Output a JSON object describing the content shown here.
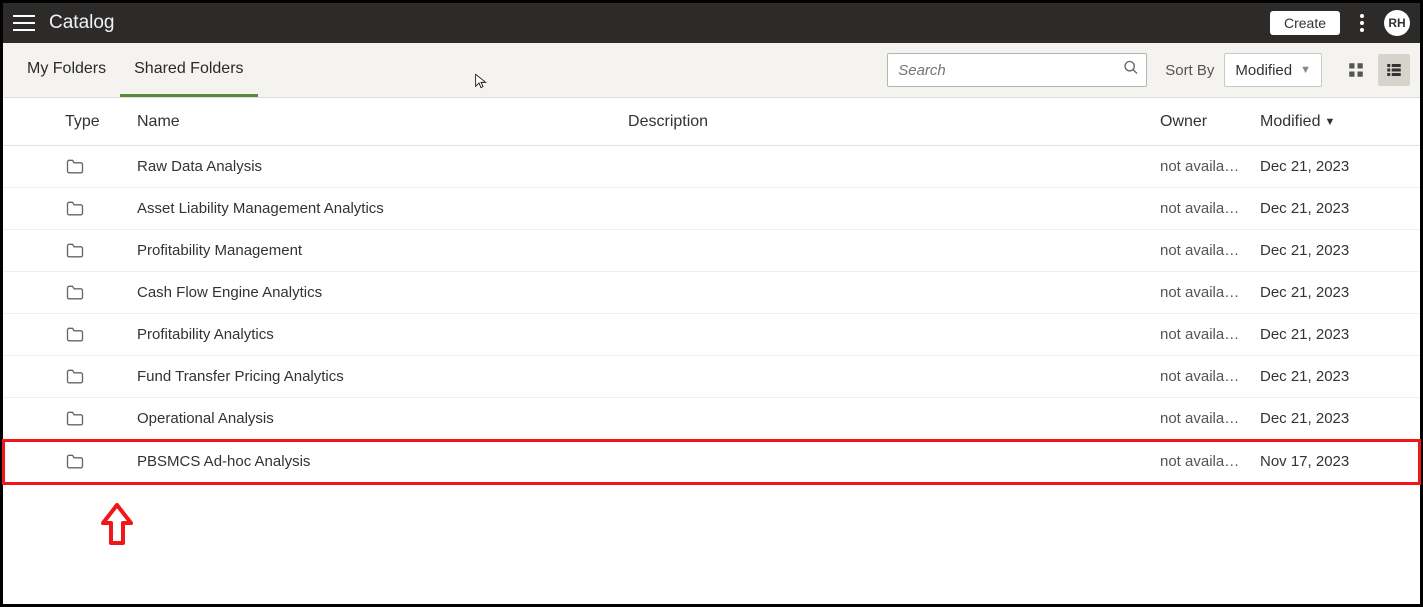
{
  "header": {
    "title": "Catalog",
    "create_label": "Create",
    "avatar_initials": "RH"
  },
  "tabs": [
    {
      "label": "My Folders",
      "active": false
    },
    {
      "label": "Shared Folders",
      "active": true
    }
  ],
  "search": {
    "placeholder": "Search"
  },
  "sort": {
    "label": "Sort By",
    "selected": "Modified"
  },
  "columns": {
    "type": "Type",
    "name": "Name",
    "description": "Description",
    "owner": "Owner",
    "modified": "Modified"
  },
  "rows": [
    {
      "name": "Raw Data Analysis",
      "description": "",
      "owner": "not availa…",
      "modified": "Dec 21, 2023",
      "highlight": false
    },
    {
      "name": "Asset Liability Management Analytics",
      "description": "",
      "owner": "not availa…",
      "modified": "Dec 21, 2023",
      "highlight": false
    },
    {
      "name": "Profitability Management",
      "description": "",
      "owner": "not availa…",
      "modified": "Dec 21, 2023",
      "highlight": false
    },
    {
      "name": "Cash Flow Engine Analytics",
      "description": "",
      "owner": "not availa…",
      "modified": "Dec 21, 2023",
      "highlight": false
    },
    {
      "name": "Profitability Analytics",
      "description": "",
      "owner": "not availa…",
      "modified": "Dec 21, 2023",
      "highlight": false
    },
    {
      "name": "Fund Transfer Pricing Analytics",
      "description": "",
      "owner": "not availa…",
      "modified": "Dec 21, 2023",
      "highlight": false
    },
    {
      "name": "Operational Analysis",
      "description": "",
      "owner": "not availa…",
      "modified": "Dec 21, 2023",
      "highlight": false
    },
    {
      "name": "PBSMCS Ad-hoc Analysis",
      "description": "",
      "owner": "not availa…",
      "modified": "Nov 17, 2023",
      "highlight": true
    }
  ]
}
